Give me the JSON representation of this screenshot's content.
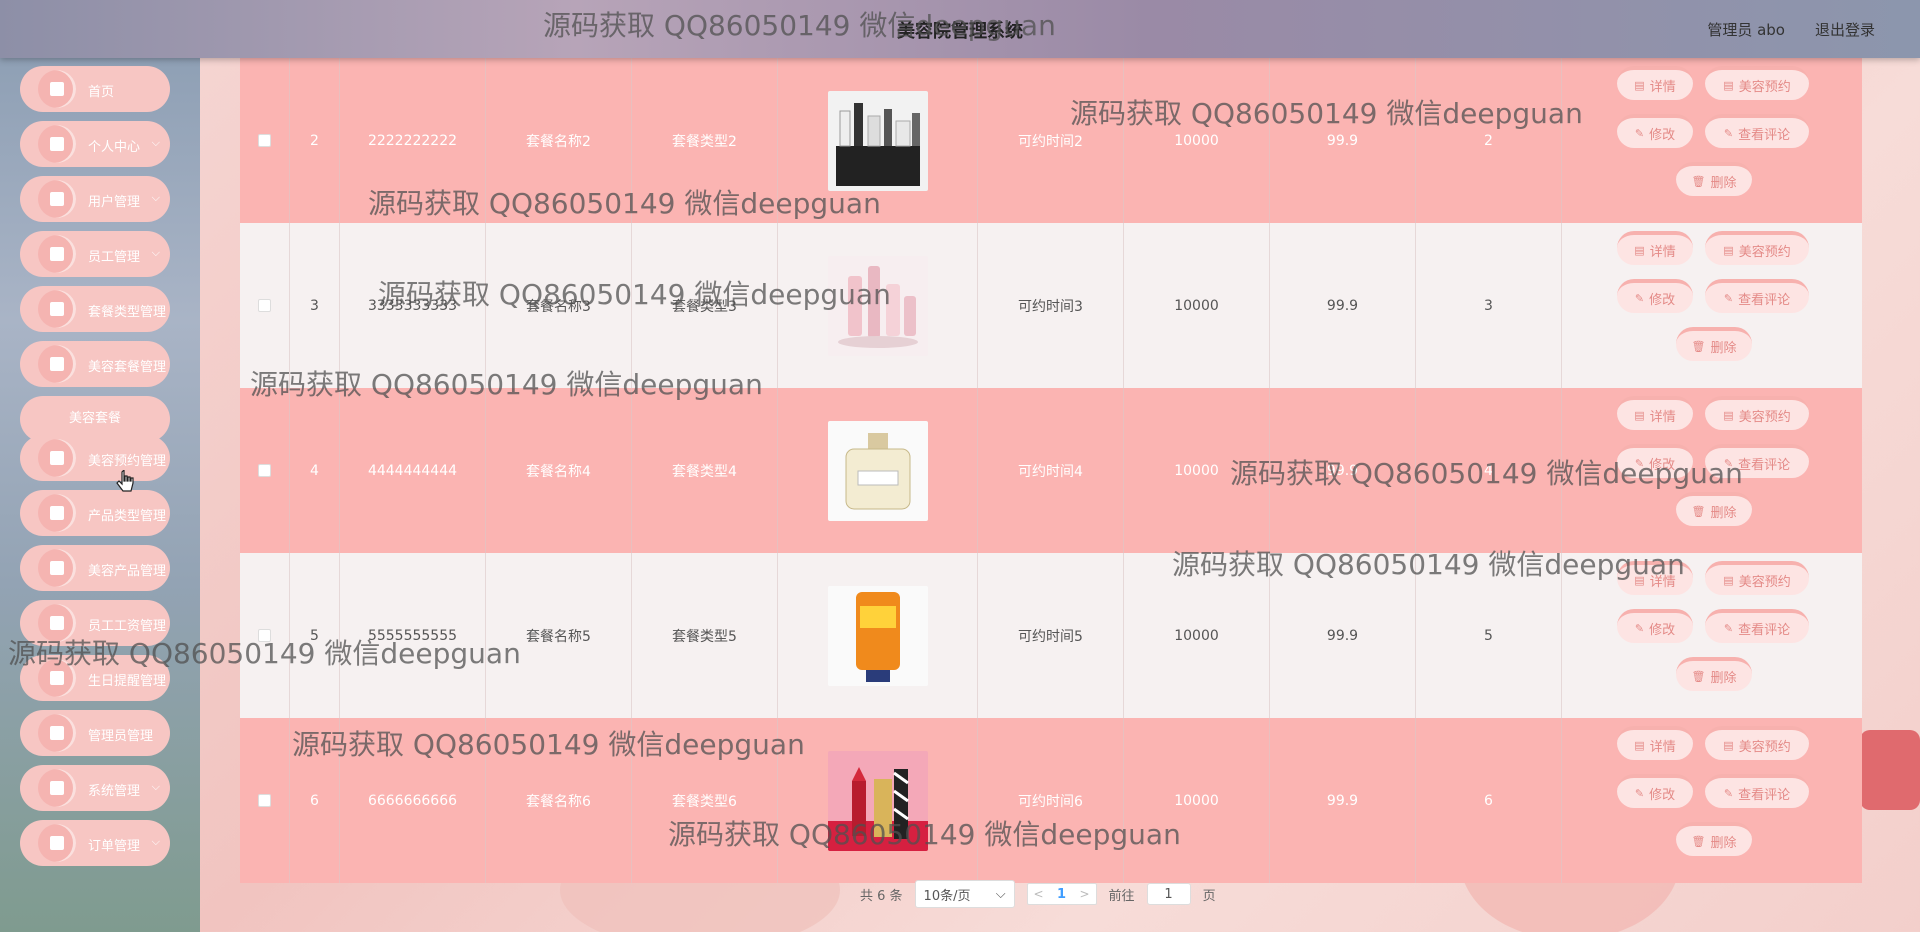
{
  "header": {
    "title": "美容院管理系统",
    "user": "管理员 abo",
    "logout": "退出登录"
  },
  "sidebar": {
    "items": [
      {
        "label": "首页",
        "icon": "home-icon",
        "chevron": ""
      },
      {
        "label": "个人中心",
        "icon": "user-icon",
        "chevron": "⌵"
      },
      {
        "label": "用户管理",
        "icon": "list-icon",
        "chevron": "⌵"
      },
      {
        "label": "员工管理",
        "icon": "staff-icon",
        "chevron": "⌵"
      },
      {
        "label": "套餐类型管理",
        "icon": "monitor-icon",
        "chevron": ""
      },
      {
        "label": "美容套餐管理",
        "icon": "grid-icon",
        "chevron": ""
      },
      {
        "label": "美容套餐",
        "sub": true
      },
      {
        "label": "美容预约管理",
        "icon": "flag-icon",
        "chevron": ""
      },
      {
        "label": "产品类型管理",
        "icon": "grid-icon",
        "chevron": ""
      },
      {
        "label": "美容产品管理",
        "icon": "grid-icon",
        "chevron": ""
      },
      {
        "label": "员工工资管理",
        "icon": "grid-icon",
        "chevron": ""
      },
      {
        "label": "生日提醒管理",
        "icon": "chart-icon",
        "chevron": ""
      },
      {
        "label": "管理员管理",
        "icon": "trash-icon",
        "chevron": ""
      },
      {
        "label": "系统管理",
        "icon": "grid-icon",
        "chevron": "⌵"
      },
      {
        "label": "订单管理",
        "icon": "grid-icon",
        "chevron": "⌵"
      }
    ]
  },
  "table": {
    "rows": [
      {
        "idx": "2",
        "no": "2222222222",
        "name": "套餐名称2",
        "type": "套餐类型2",
        "image": "cosmetics-set",
        "time": "可约时间2",
        "price": "10000",
        "discount": "99.9",
        "count": "2",
        "style": "pink"
      },
      {
        "idx": "3",
        "no": "3333333333",
        "name": "套餐名称3",
        "type": "套餐类型3",
        "image": "pink-bottles",
        "time": "可约时间3",
        "price": "10000",
        "discount": "99.9",
        "count": "3",
        "style": "light"
      },
      {
        "idx": "4",
        "no": "4444444444",
        "name": "套餐名称4",
        "type": "套餐类型4",
        "image": "perfume",
        "time": "可约时间4",
        "price": "10000",
        "discount": "99.9",
        "count": "4",
        "style": "pink"
      },
      {
        "idx": "5",
        "no": "5555555555",
        "name": "套餐名称5",
        "type": "套餐类型5",
        "image": "sunscreen",
        "time": "可约时间5",
        "price": "10000",
        "discount": "99.9",
        "count": "5",
        "style": "light"
      },
      {
        "idx": "6",
        "no": "6666666666",
        "name": "套餐名称6",
        "type": "套餐类型6",
        "image": "lipstick",
        "time": "可约时间6",
        "price": "10000",
        "discount": "99.9",
        "count": "6",
        "style": "pink"
      }
    ],
    "ops": {
      "detail": "详情",
      "appoint": "美容预约",
      "edit": "修改",
      "review": "查看评论",
      "delete": "删除"
    }
  },
  "pager": {
    "total": "共 6 条",
    "page_size": "10条/页",
    "current": "1",
    "goto_label": "前往",
    "goto_value": "1",
    "page_unit": "页"
  },
  "watermark": "源码获取 QQ86050149 微信deepguan",
  "colors": {
    "pink_row": "#fbb4b2",
    "light_row": "#f6f1f1",
    "menu_bg": "#f7c6c3",
    "button_text": "#e48a87"
  }
}
